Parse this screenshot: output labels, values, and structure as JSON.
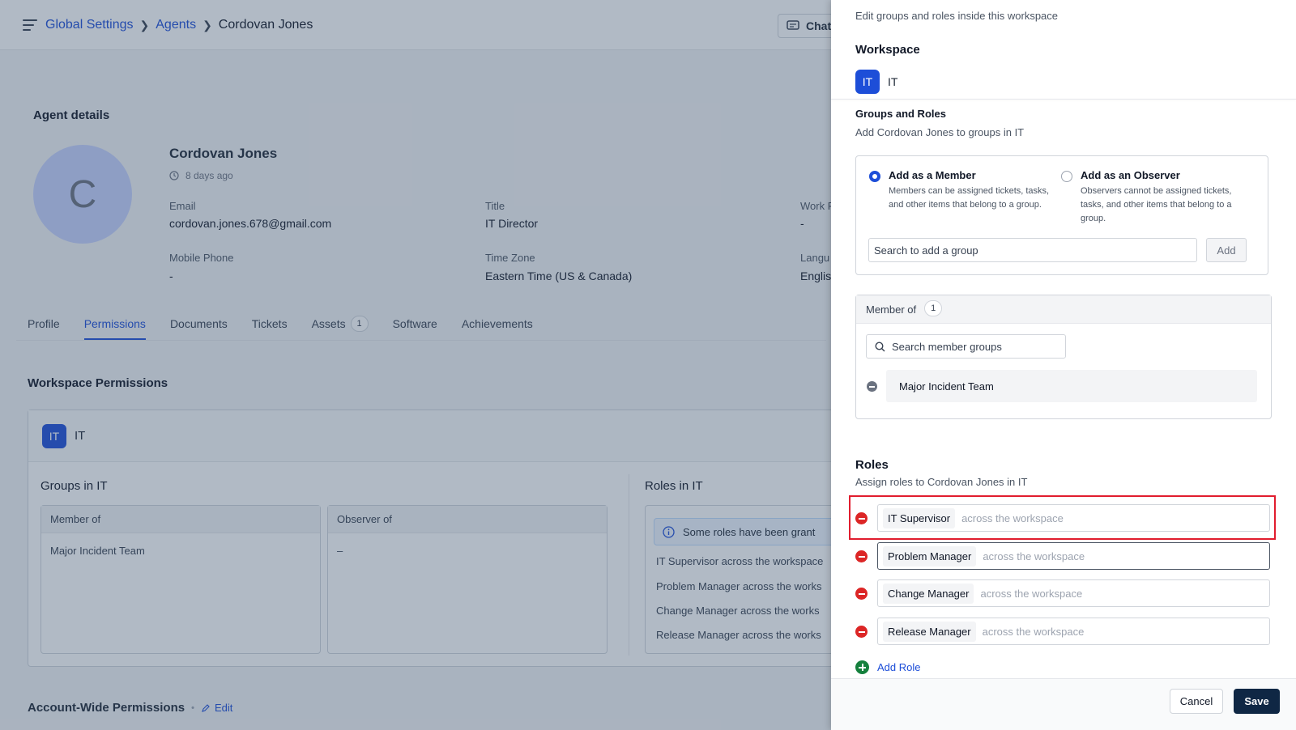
{
  "breadcrumb": {
    "item1": "Global Settings",
    "item2": "Agents",
    "current": "Cordovan Jones"
  },
  "topbar": {
    "chat_label": "Chat"
  },
  "agent": {
    "section_title": "Agent details",
    "avatar_initial": "C",
    "name": "Cordovan Jones",
    "last_seen": "8 days ago",
    "email_label": "Email",
    "email": "cordovan.jones.678@gmail.com",
    "title_label": "Title",
    "title": "IT Director",
    "work_label": "Work P",
    "work": "-",
    "mobile_label": "Mobile Phone",
    "mobile": "-",
    "tz_label": "Time Zone",
    "tz": "Eastern Time (US & Canada)",
    "lang_label": "Langu",
    "lang": "Englis"
  },
  "tabs": [
    {
      "label": "Profile"
    },
    {
      "label": "Permissions"
    },
    {
      "label": "Documents"
    },
    {
      "label": "Tickets"
    },
    {
      "label": "Assets",
      "count": "1"
    },
    {
      "label": "Software"
    },
    {
      "label": "Achievements"
    }
  ],
  "permissions": {
    "title": "Workspace Permissions",
    "ws_badge": "IT",
    "ws_name": "IT",
    "groups_title": "Groups in IT",
    "member_of_label": "Member of",
    "member_of_value": "Major Incident Team",
    "observer_of_label": "Observer of",
    "observer_of_value": "–",
    "roles_title": "Roles in IT",
    "info_text": "Some roles have been grant",
    "roles": [
      "IT Supervisor across the workspace",
      "Problem Manager across the works",
      "Change Manager across the works",
      "Release Manager across the works"
    ],
    "account_wide": "Account-Wide Permissions",
    "account_dot": "•",
    "edit_label": "Edit"
  },
  "panel": {
    "intro": "Edit groups and roles inside this workspace",
    "workspace_title": "Workspace",
    "ws_badge": "IT",
    "ws_name": "IT",
    "groups_title": "Groups and Roles",
    "groups_sub": "Add Cordovan Jones to groups in IT",
    "member_option": {
      "title": "Add as a Member",
      "desc": "Members can be assigned tickets, tasks, and other items that belong to a group."
    },
    "observer_option": {
      "title": "Add as an Observer",
      "desc": "Observers cannot be assigned tickets, tasks, and other items that belong to a group."
    },
    "group_search_placeholder": "Search to add a group",
    "add_button": "Add",
    "member_of_label": "Member of",
    "member_count": "1",
    "member_search_placeholder": "Search member groups",
    "member_groups": [
      "Major Incident Team"
    ],
    "roles_title": "Roles",
    "roles_sub": "Assign roles to Cordovan Jones in IT",
    "roles": [
      {
        "name": "IT Supervisor",
        "scope": "across the workspace"
      },
      {
        "name": "Problem Manager",
        "scope": "across the workspace"
      },
      {
        "name": "Change Manager",
        "scope": "across the workspace"
      },
      {
        "name": "Release Manager",
        "scope": "across the workspace"
      }
    ],
    "add_role": "Add Role",
    "cancel": "Cancel",
    "save": "Save"
  },
  "colors": {
    "accent": "#1d4ed8",
    "danger": "#dc2626",
    "highlight": "#e11d2e",
    "primary_button": "#0f2744"
  }
}
